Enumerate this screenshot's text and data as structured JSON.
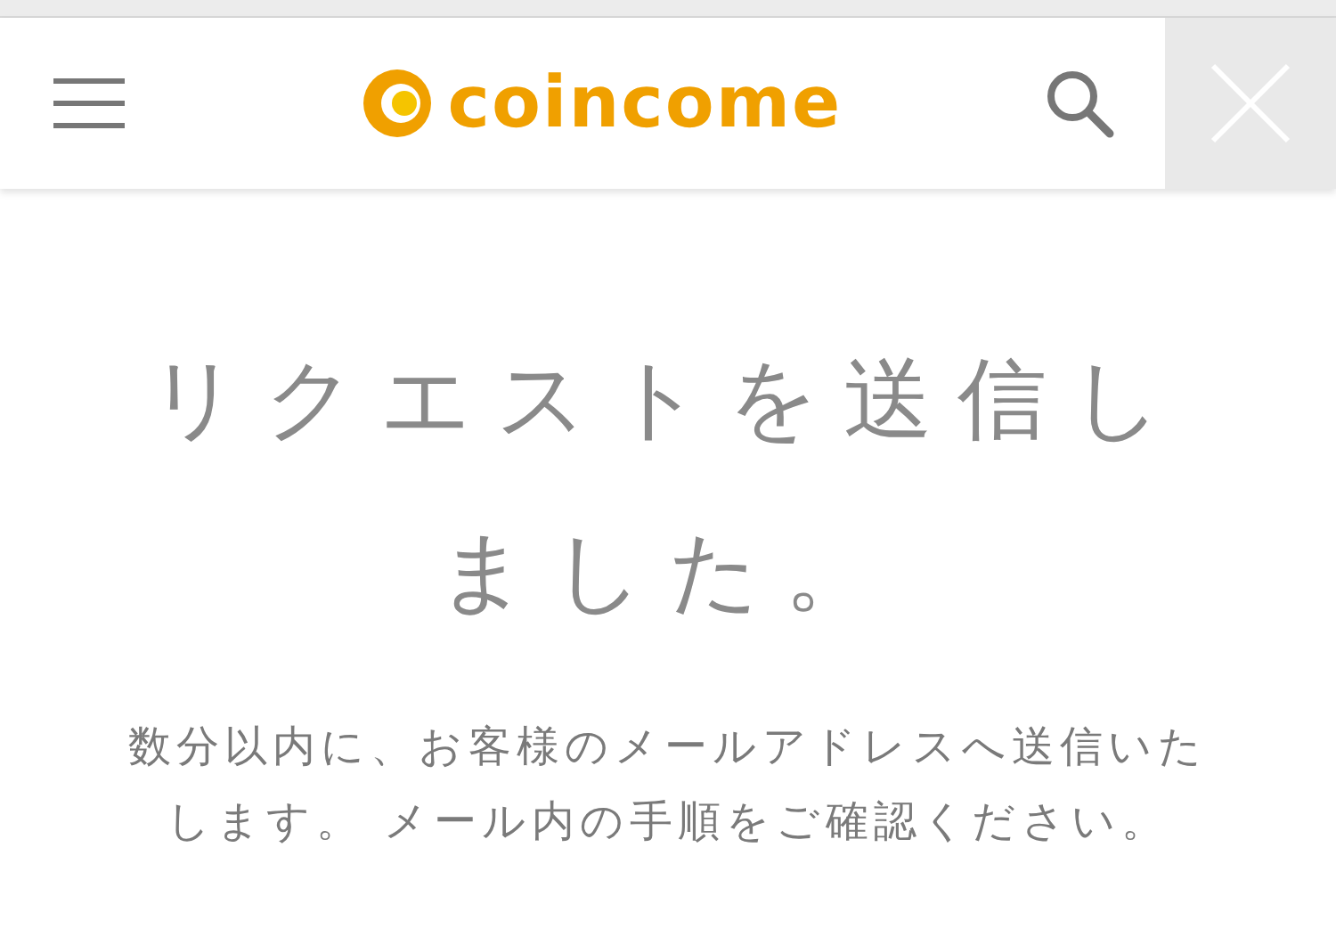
{
  "header": {
    "logo_text": "coincome"
  },
  "message": {
    "title": "リクエストを送信しました。",
    "body": "数分以内に、お客様のメールアドレスへ送信いたします。 メール内の手順をご確認ください。"
  }
}
